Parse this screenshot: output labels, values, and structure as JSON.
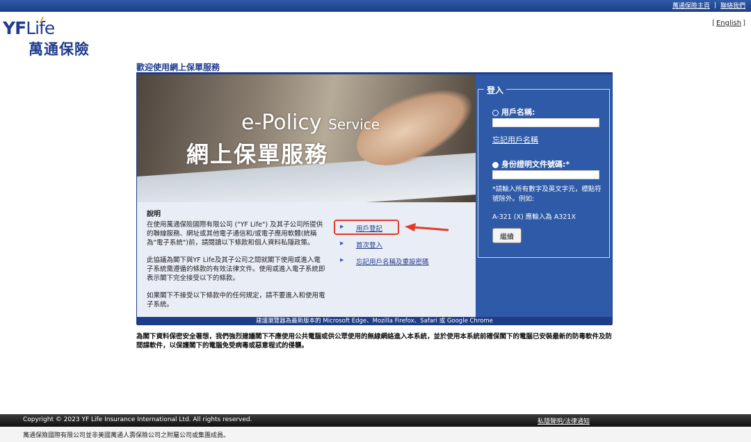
{
  "topnav": {
    "home": "萬通保險主頁",
    "sep": "|",
    "contact": "聯絡我們"
  },
  "lang": {
    "open": "[",
    "english": "English",
    "close": "]"
  },
  "logo": {
    "latin_bold": "YF",
    "latin": "Life",
    "chinese": "萬通保險"
  },
  "page_heading": "歡迎使用網上保單服務",
  "hero": {
    "line1_main": "e-Policy",
    "line1_small": "Service",
    "line2": "網上保單服務"
  },
  "description": {
    "title": "說明",
    "paragraphs": [
      "在使用萬通保險國際有限公司 (\"YF Life\") 及其子公司所提供的聯線服務、網址或其他電子通信和/或電子應用軟體(統稱為\"電子系統\")前，請閱讀以下條款和個人資料私隱政策。",
      "此協議為閣下與YF Life及其子公司之間就閣下使用或進入電子系統需遵循的條款的有效法律文件。使用或進入電子系統即表示閣下完全接受以下的條款。",
      "如果閣下不接受以下條款中的任何規定，請不要進入和使用電子系統。"
    ]
  },
  "links": [
    {
      "label": "用戶登記"
    },
    {
      "label": "首次登入"
    },
    {
      "label": "忘記用戶名稱及重設密碼"
    }
  ],
  "login": {
    "title": "登入",
    "username_label": "用戶名稱:",
    "username_value": "",
    "forgot_username": "忘記用戶名稱",
    "id_label": "身份證明文件號碼:*",
    "id_value": "",
    "note": "*請輸入所有數字及英文字元，標點符號除外。例如:",
    "example": "A-321 (X) 應輸入為 A321X",
    "continue_button": "繼續"
  },
  "browser_notice": "建議瀏覽器為最新版本的 Microsoft Edge、Mozilla Firefox、Safari 或 Google Chrome",
  "security_warning": "為閣下資料保密安全著想，我們強烈建議閣下不應使用公共電腦或供公眾使用的無線網絡進入本系統，並於使用本系統前確保閣下的電腦已安裝最新的防毒軟件及防間諜軟件，以保護閣下的電腦免受病毒或惡意程式的侵襲。",
  "footer": {
    "copyright": "Copyright © 2023 YF Life Insurance International Ltd. All rights reserved.",
    "privacy": "私隱聲明/法律通知",
    "affiliation": "萬通保險國際有限公司並非美國萬通人壽保險公司之附屬公司或集團成員。"
  },
  "colors": {
    "brand_blue": "#1f3c8e",
    "panel_blue": "#2f5aa7",
    "highlight_red": "#e03a2a",
    "logo_accent": "#e29b2e"
  }
}
